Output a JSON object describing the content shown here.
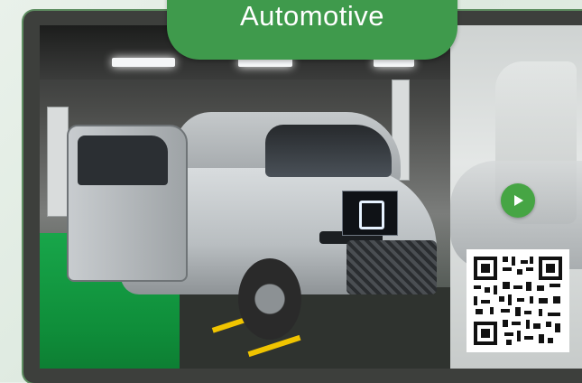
{
  "header": {
    "category_label": "Automotive"
  },
  "media": {
    "photo_subject": "vehicle-assembly-line",
    "play_icon": "play-icon",
    "qr_icon": "qr-code-icon"
  },
  "colors": {
    "accent_green": "#3f9a4c",
    "play_green": "#46a544",
    "card_frame": "#3d3f3c"
  }
}
